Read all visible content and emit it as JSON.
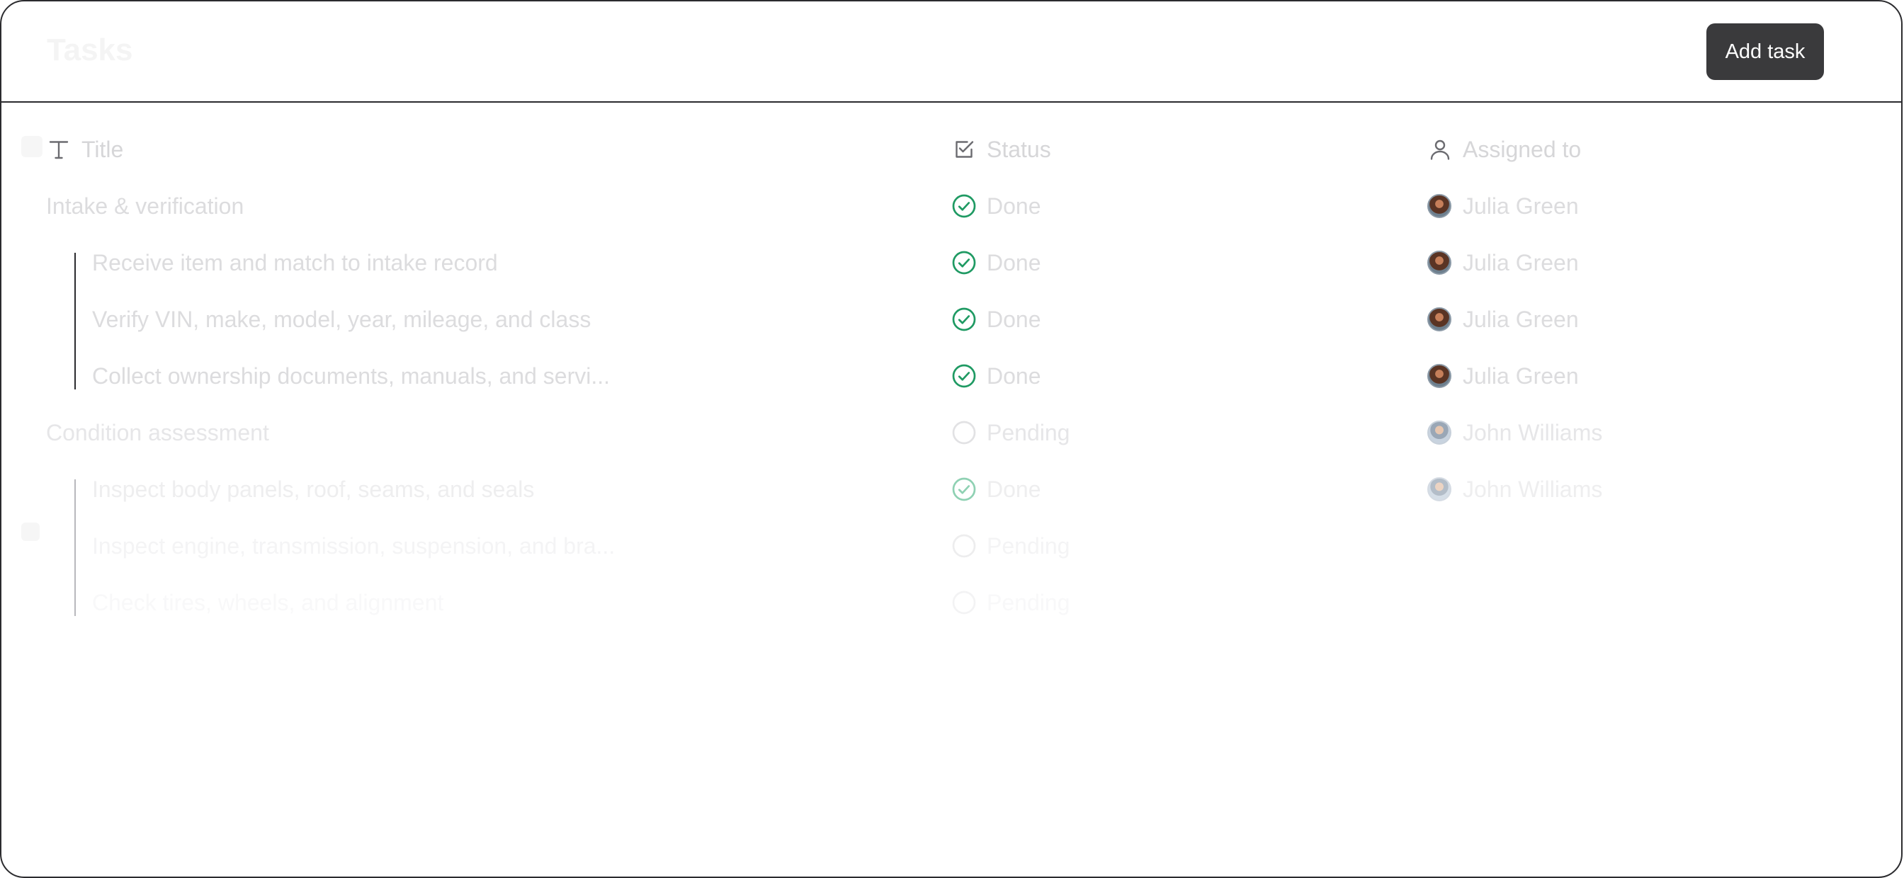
{
  "header": {
    "title": "Tasks",
    "add_task_label": "Add task"
  },
  "columns": {
    "title": "Title",
    "status": "Status",
    "assigned_to": "Assigned to"
  },
  "rows": [
    {
      "title": "Intake & verification",
      "status": "Done",
      "assignee": "Julia Green"
    },
    {
      "title": "Receive item and match to intake record",
      "status": "Done",
      "assignee": "Julia Green"
    },
    {
      "title": "Verify VIN, make, model, year, mileage, and class",
      "status": "Done",
      "assignee": "Julia Green"
    },
    {
      "title": "Collect ownership documents, manuals, and servi...",
      "status": "Done",
      "assignee": "Julia Green"
    },
    {
      "title": "Condition assessment",
      "status": "Pending",
      "assignee": "John Williams"
    },
    {
      "title": "Inspect body panels, roof, seams, and seals",
      "status": "Done",
      "assignee": "John Williams"
    },
    {
      "title": "Inspect engine, transmission, suspension, and bra...",
      "status": "Pending",
      "assignee": ""
    },
    {
      "title": "Check tires, wheels, and alignment",
      "status": "Pending",
      "assignee": ""
    }
  ],
  "colors": {
    "done": "#1f9a63",
    "button_bg": "#3a3a3c",
    "border": "#2b2b2e"
  },
  "icons": {
    "title_column": "text-icon",
    "status_column": "checkbox-icon",
    "assigned_column": "user-icon",
    "done": "check-circle-icon",
    "pending": "empty-circle-icon"
  }
}
